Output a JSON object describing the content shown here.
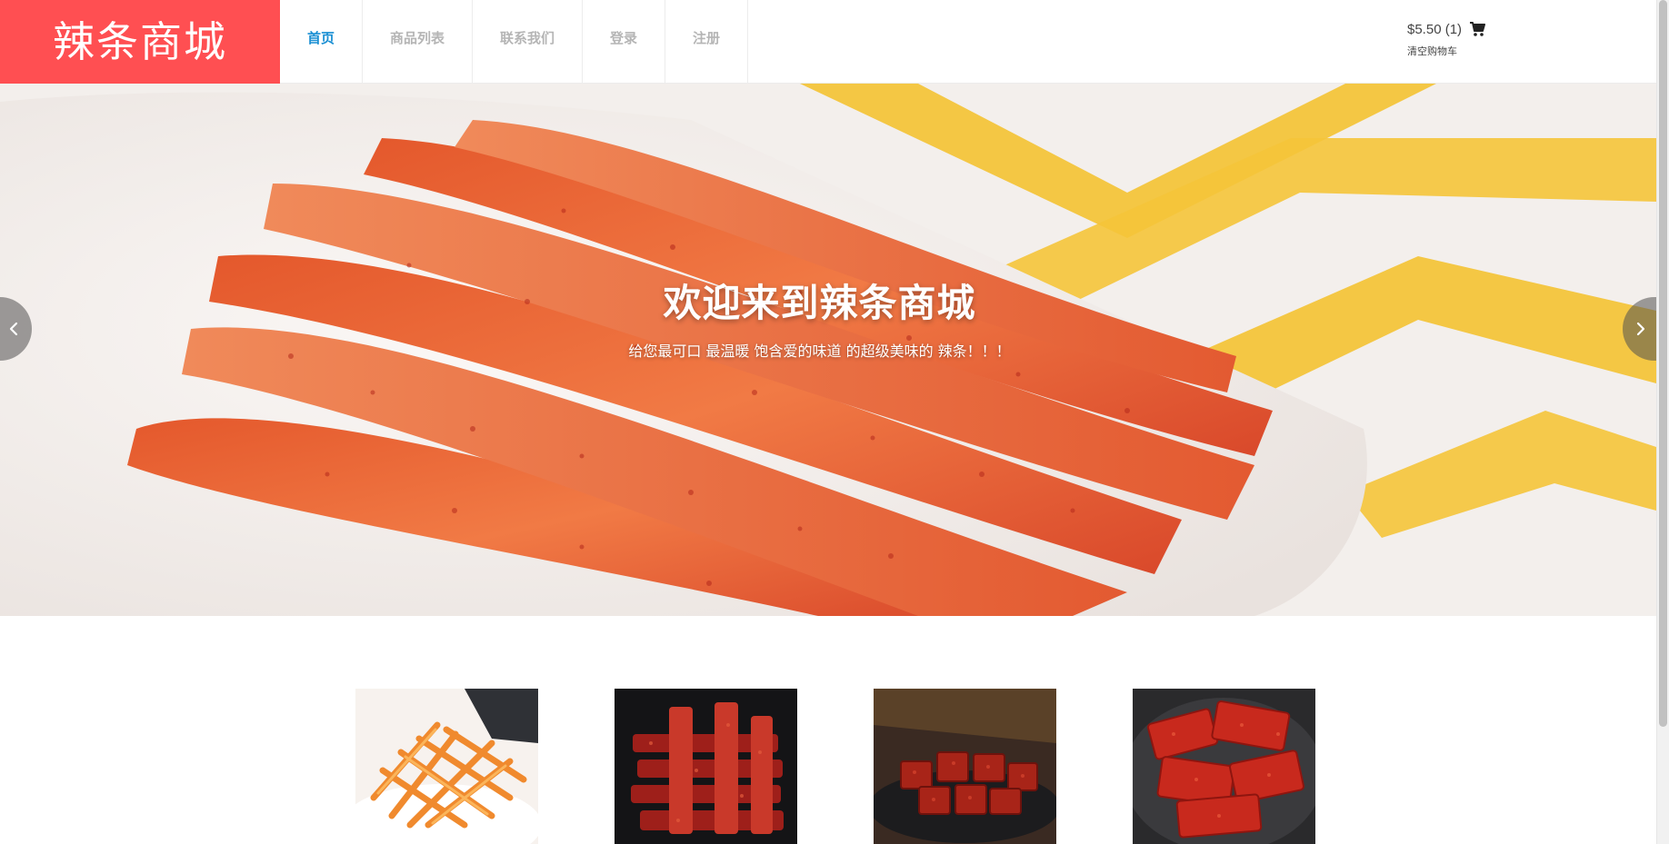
{
  "header": {
    "logo_text": "辣条商城",
    "nav": [
      {
        "label": "首页",
        "active": true
      },
      {
        "label": "商品列表",
        "active": false
      },
      {
        "label": "联系我们",
        "active": false
      },
      {
        "label": "登录",
        "active": false
      },
      {
        "label": "注册",
        "active": false
      }
    ],
    "cart": {
      "total": "$5.50 (1)",
      "clear_label": "清空购物车",
      "icon": "shopping-cart-icon"
    }
  },
  "hero": {
    "title": "欢迎来到辣条商城",
    "subtitle": "给您最可口 最温暖 饱含爱的味道 的超级美味的 辣条！！！",
    "prev_icon": "chevron-left-icon",
    "next_icon": "chevron-right-icon"
  },
  "products": [
    {
      "image": "product-image-spicy-sticks"
    },
    {
      "image": "product-image-spicy-strips-stack"
    },
    {
      "image": "product-image-spicy-cubes-plate"
    },
    {
      "image": "product-image-spicy-slices-bowl"
    }
  ],
  "colors": {
    "brand": "#ff4f52",
    "nav_active": "#1a8fd3",
    "nav_inactive": "#b5b5b5"
  }
}
